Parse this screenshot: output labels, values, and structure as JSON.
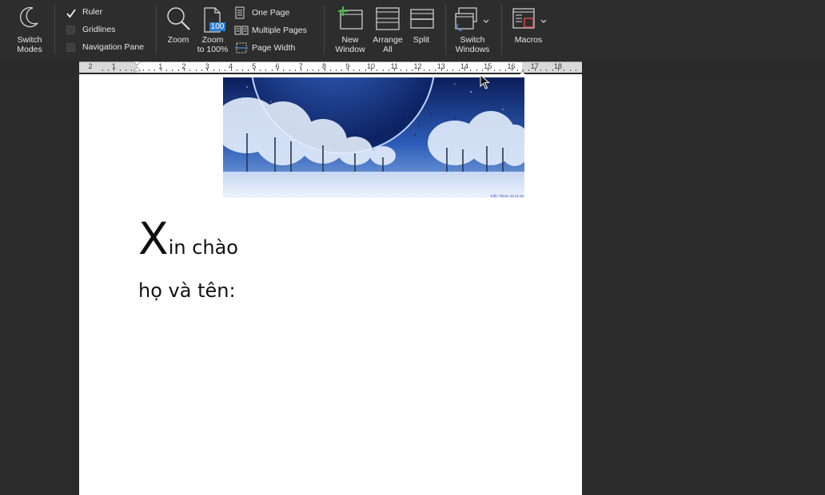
{
  "ribbon": {
    "switch_modes": "Switch\nModes",
    "show": [
      {
        "label": "Ruler",
        "checked": true
      },
      {
        "label": "Gridlines",
        "checked": false
      },
      {
        "label": "Navigation Pane",
        "checked": false
      }
    ],
    "zoom": "Zoom",
    "zoom_100": "Zoom\nto 100%",
    "zoom_100_badge": "100",
    "one_page": "One Page",
    "multiple_pages": "Multiple Pages",
    "page_width": "Page Width",
    "new_window": "New\nWindow",
    "arrange_all": "Arrange\nAll",
    "split": "Split",
    "switch_windows": "Switch\nWindows",
    "macros": "Macros"
  },
  "ruler": {
    "numbers": [
      "2",
      "1",
      "1",
      "2",
      "3",
      "4",
      "5",
      "6",
      "7",
      "8",
      "9",
      "10",
      "11",
      "12",
      "13",
      "14",
      "15",
      "16",
      "17",
      "18"
    ]
  },
  "document": {
    "greeting_big": "X",
    "greeting_rest": "in chào",
    "name_line": "họ và tên:",
    "image_caption": "Kiến Tâmm 18.11.06"
  }
}
